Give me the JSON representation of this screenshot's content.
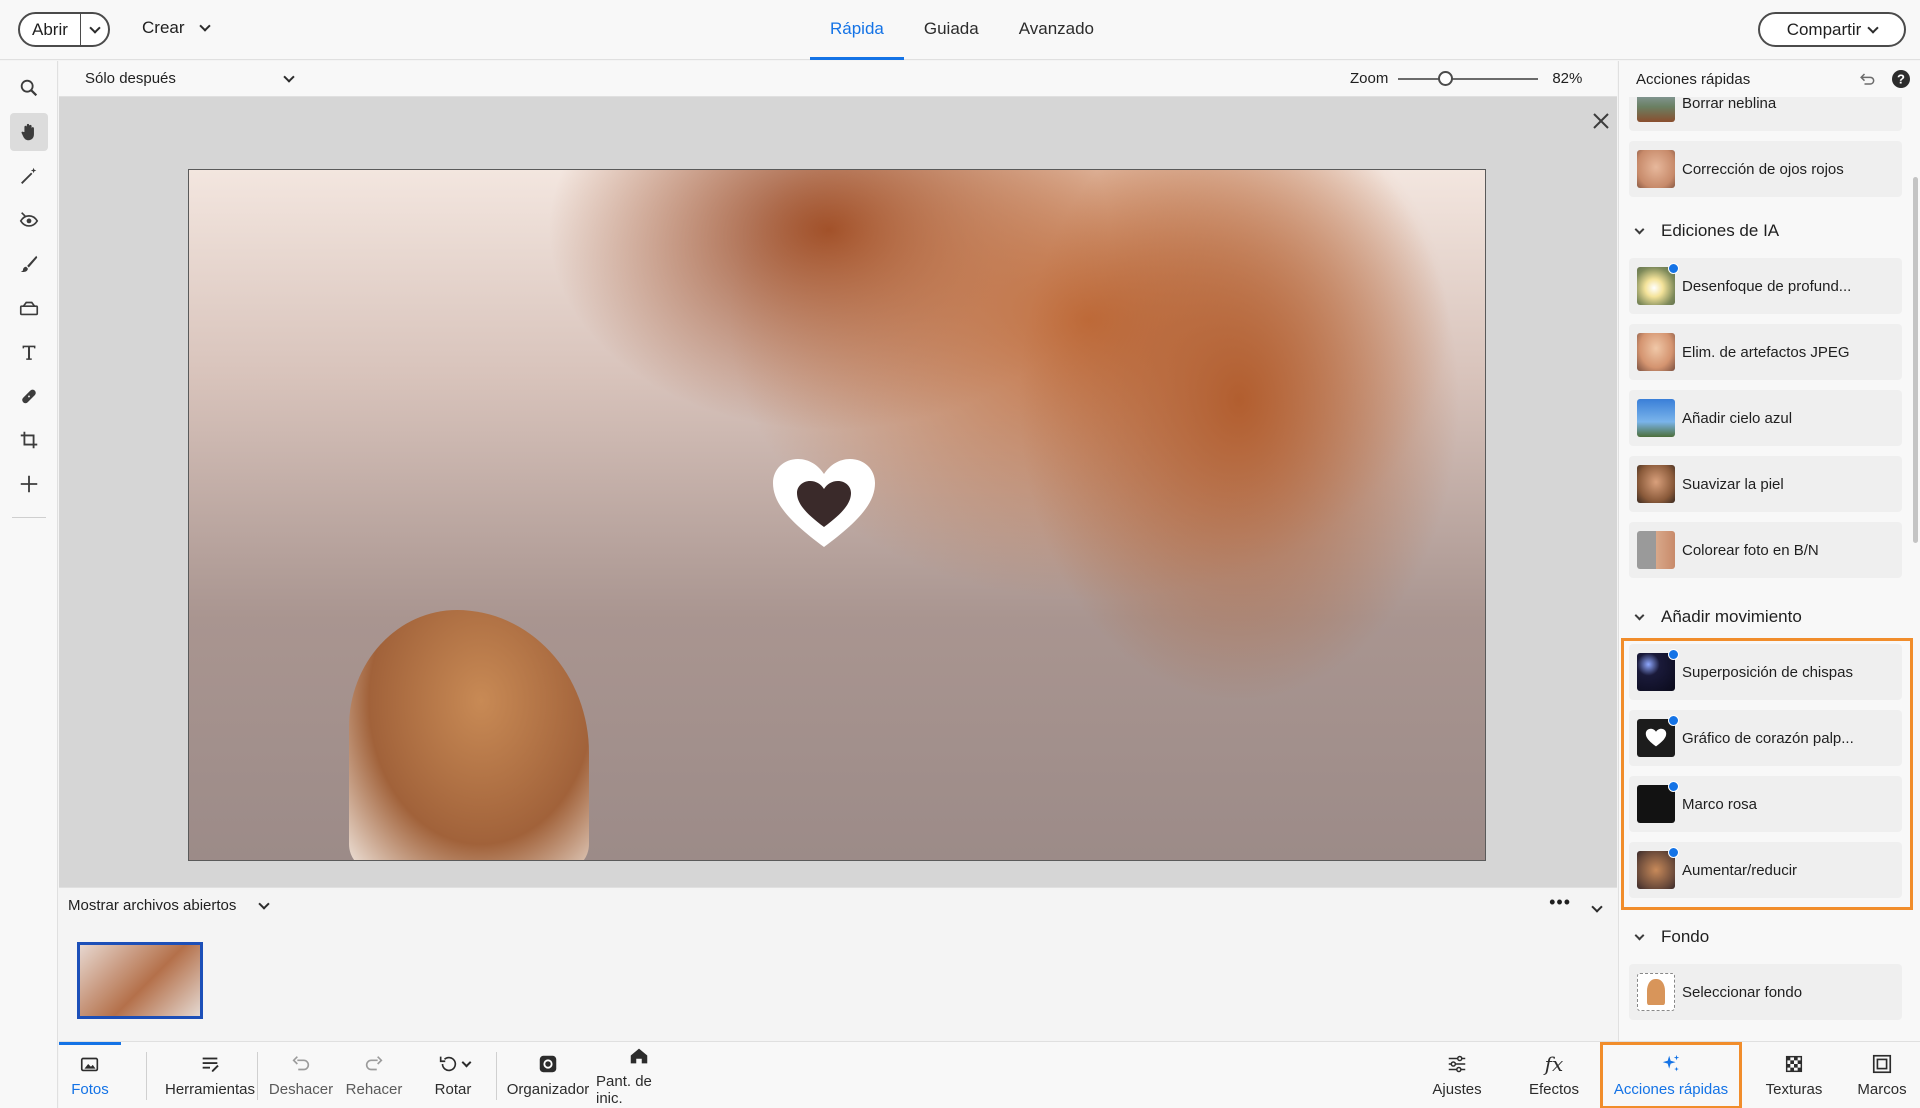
{
  "header": {
    "open_label": "Abrir",
    "create_label": "Crear",
    "modes": [
      "Rápida",
      "Guiada",
      "Avanzado"
    ],
    "active_mode": "Rápida",
    "share_label": "Compartir"
  },
  "tools": [
    "zoom-tool",
    "hand-tool",
    "quick-selection-tool",
    "red-eye-tool",
    "whiten-teeth-tool",
    "straighten-tool",
    "text-tool",
    "spot-healing-tool",
    "crop-tool",
    "move-tool"
  ],
  "options": {
    "view_label": "Sólo después",
    "zoom_label": "Zoom",
    "zoom_value": "82%",
    "zoom_fraction": 0.33
  },
  "filmstrip": {
    "show_label": "Mostrar archivos abiertos",
    "more": "•••"
  },
  "bottombar": {
    "fotos": "Fotos",
    "herramientas": "Herramientas",
    "deshacer": "Deshacer",
    "rehacer": "Rehacer",
    "rotar": "Rotar",
    "organizador": "Organizador",
    "inicio": "Pant. de inic.",
    "ajustes": "Ajustes",
    "efectos": "Efectos",
    "acciones": "Acciones rápidas",
    "texturas": "Texturas",
    "marcos": "Marcos"
  },
  "panel": {
    "title": "Acciones rápidas",
    "items_top": [
      "Borrar neblina",
      "Corrección de ojos rojos"
    ],
    "sections": {
      "ia": "Ediciones de IA",
      "movimiento": "Añadir movimiento",
      "fondo": "Fondo"
    },
    "ia_items": [
      "Desenfoque de profund...",
      "Elim. de artefactos JPEG",
      "Añadir cielo azul",
      "Suavizar la piel",
      "Colorear foto en B/N"
    ],
    "movimiento_items": [
      "Superposición de chispas",
      "Gráfico de corazón palp...",
      "Marco rosa",
      "Aumentar/reducir"
    ],
    "fondo_items": [
      "Seleccionar fondo"
    ]
  },
  "colors": {
    "accent": "#1473e6",
    "highlight": "#f18d2b",
    "badge": "#1473e6"
  }
}
